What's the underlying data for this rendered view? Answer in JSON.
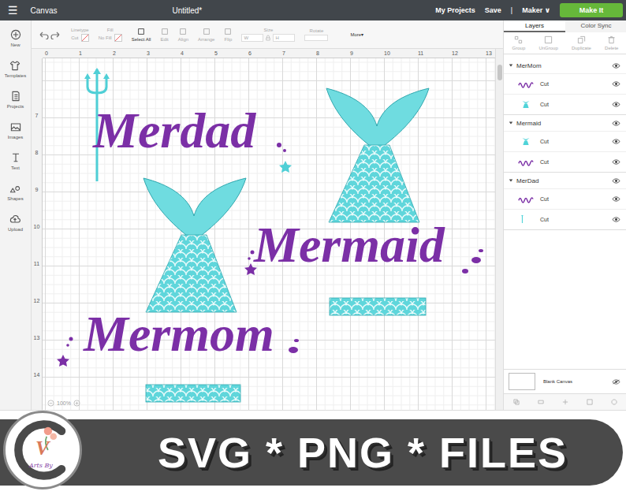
{
  "topbar": {
    "menu": "☰",
    "app": "Canvas",
    "title": "Untitled*",
    "links": [
      "My Projects",
      "Save"
    ],
    "divider": "|",
    "machine": "Maker ∨",
    "make_it": "Make It"
  },
  "toolbar": {
    "fields": [
      {
        "label": "Linetype",
        "value": "Cut",
        "disabled": true
      },
      {
        "label": "Fill",
        "value": "No Fill",
        "disabled": true
      }
    ],
    "actions": [
      {
        "label": "Select All",
        "disabled": false
      },
      {
        "label": "Edit",
        "disabled": true
      },
      {
        "label": "Align",
        "disabled": true
      },
      {
        "label": "Arrange",
        "disabled": true
      },
      {
        "label": "Flip",
        "disabled": true
      }
    ],
    "size": {
      "label": "Size",
      "w": "W",
      "h": "H",
      "disabled": true
    },
    "rotate": {
      "label": "Rotate",
      "disabled": true
    },
    "more": "More▾"
  },
  "sidebar": [
    {
      "label": "New"
    },
    {
      "label": "Templates"
    },
    {
      "label": "Projects"
    },
    {
      "label": "Images"
    },
    {
      "label": "Text"
    },
    {
      "label": "Shapes"
    },
    {
      "label": "Upload"
    }
  ],
  "ruler": {
    "top": [
      "0",
      "1",
      "2",
      "3",
      "4",
      "5",
      "6",
      "7",
      "8",
      "9",
      "10",
      "11",
      "12",
      "13"
    ],
    "left": [
      "7",
      "8",
      "9",
      "10",
      "11",
      "12",
      "13",
      "14"
    ]
  },
  "canvas": {
    "words": [
      "Merdad",
      "Mermaid",
      "Mermom"
    ],
    "zoom": "100%"
  },
  "layers_panel": {
    "tabs": [
      {
        "label": "Layers",
        "selected": true
      },
      {
        "label": "Color Sync",
        "selected": false
      }
    ],
    "actions": [
      {
        "label": "Group",
        "disabled": true
      },
      {
        "label": "UnGroup",
        "disabled": true
      },
      {
        "label": "Duplicate",
        "disabled": true
      },
      {
        "label": "Delete",
        "disabled": true
      }
    ],
    "groups": [
      {
        "name": "MerMom",
        "expanded": true,
        "visible": true,
        "items": [
          {
            "label": "Cut",
            "kind": "text",
            "color": "#7b2fa6",
            "visible": true
          },
          {
            "label": "Cut",
            "kind": "tail",
            "color": "#4fd3d8",
            "visible": true
          }
        ]
      },
      {
        "name": "Mermaid",
        "expanded": true,
        "visible": true,
        "items": [
          {
            "label": "Cut",
            "kind": "tail",
            "color": "#4fd3d8",
            "visible": true
          },
          {
            "label": "Cut",
            "kind": "text",
            "color": "#7b2fa6",
            "visible": true
          }
        ]
      },
      {
        "name": "MerDad",
        "expanded": true,
        "visible": true,
        "items": [
          {
            "label": "Cut",
            "kind": "text",
            "color": "#7b2fa6",
            "visible": true
          },
          {
            "label": "Cut",
            "kind": "trident",
            "color": "#4fd3d8",
            "visible": true
          }
        ]
      }
    ],
    "blank_canvas": {
      "label": "Blank Canvas",
      "visible": false
    }
  },
  "banner": {
    "text": "SVG * PNG * FILES",
    "logo": {
      "letter": "V",
      "script": "Arts By"
    }
  }
}
